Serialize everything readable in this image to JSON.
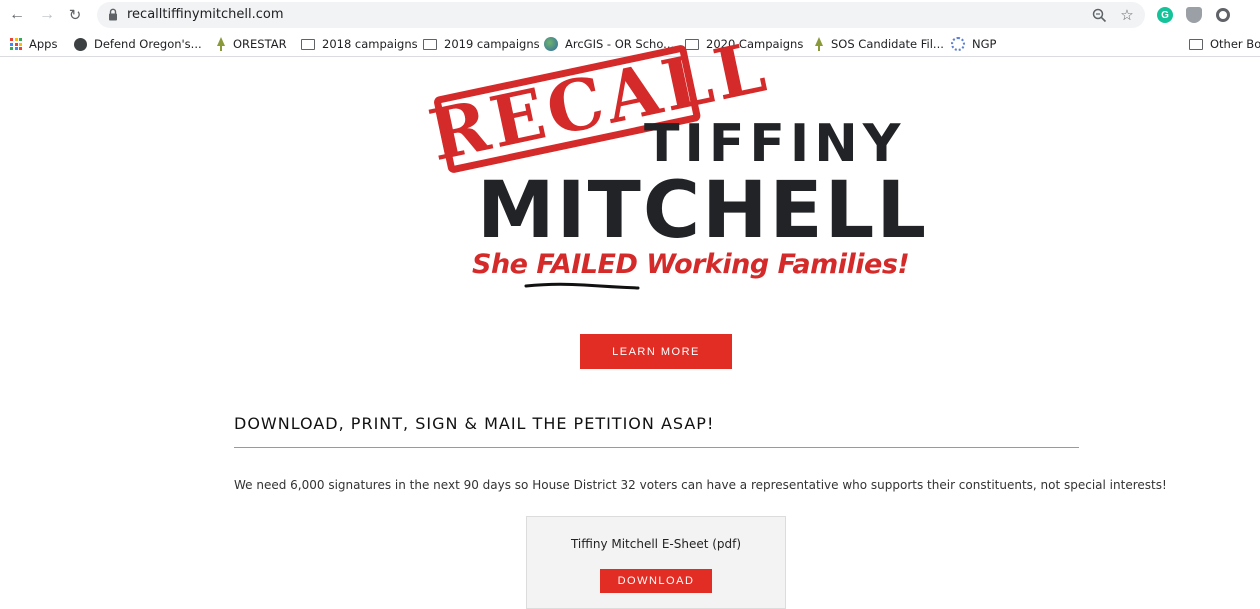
{
  "browser": {
    "url": "recalltiffinymitchell.com",
    "bookmarks": [
      {
        "label": "Apps",
        "icon": "apps-grid-icon"
      },
      {
        "label": "Defend Oregon's...",
        "icon": "globe-icon"
      },
      {
        "label": "ORESTAR",
        "icon": "tree-icon"
      },
      {
        "label": "2018 campaigns",
        "icon": "folder-icon"
      },
      {
        "label": "2019 campaigns",
        "icon": "folder-icon"
      },
      {
        "label": "ArcGIS - OR Scho...",
        "icon": "arcgis-icon"
      },
      {
        "label": "2020 Campaigns",
        "icon": "folder-icon"
      },
      {
        "label": "SOS Candidate Fil...",
        "icon": "tree-icon"
      },
      {
        "label": "NGP",
        "icon": "ngp-icon"
      }
    ],
    "other_bookmarks": "Other Bo",
    "extension_g_letter": "G"
  },
  "hero": {
    "stamp": "RECALL",
    "first_name": "TIFFINY",
    "last_name": "MITCHELL",
    "tagline_prefix": "She ",
    "tagline_emphasis": "FAILED",
    "tagline_suffix": " Working Families!",
    "learn_more_label": "LEARN MORE"
  },
  "petition": {
    "heading": "DOWNLOAD, PRINT, SIGN & MAIL THE PETITION ASAP!",
    "intro": "We need 6,000 signatures in the next 90 days so House District 32 voters can  have a representative who supports their constituents, not special interests!",
    "card_title": "Tiffiny Mitchell E-Sheet (pdf)",
    "download_label": "DOWNLOAD"
  },
  "colors": {
    "brand_red": "#e12d24",
    "stamp_red": "#d42a2a",
    "name_dark": "#222326"
  }
}
